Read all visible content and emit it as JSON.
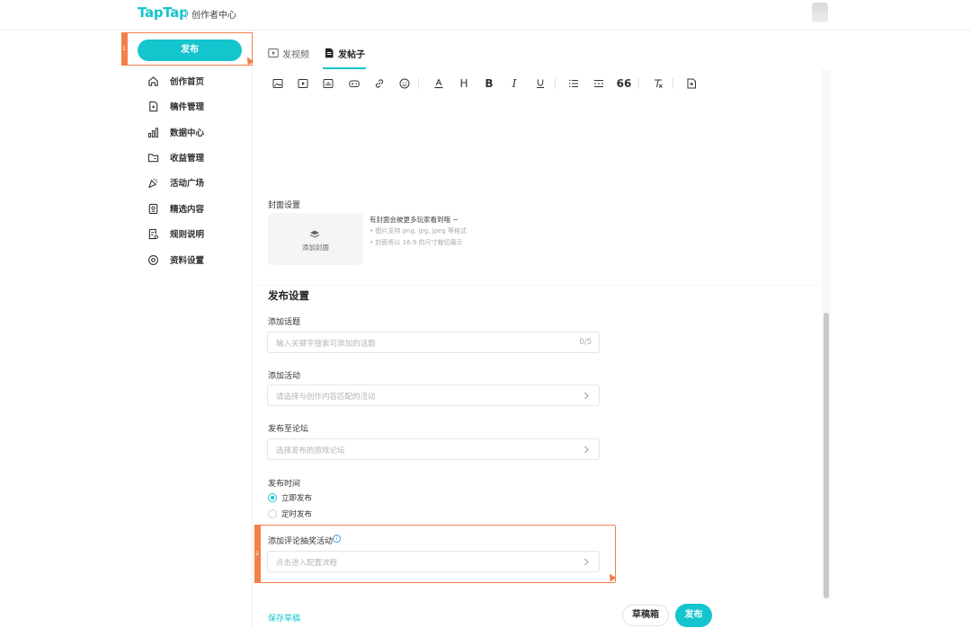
{
  "header": {
    "logo": "TapTap",
    "subtitle": "创作者中心"
  },
  "sidebar": {
    "publish_label": "发布",
    "highlight_tag_1": "1",
    "items": [
      {
        "label": "创作首页",
        "icon": "home-icon"
      },
      {
        "label": "稿件管理",
        "icon": "document-icon"
      },
      {
        "label": "数据中心",
        "icon": "bar-chart-icon"
      },
      {
        "label": "收益管理",
        "icon": "folder-icon"
      },
      {
        "label": "活动广场",
        "icon": "party-icon"
      },
      {
        "label": "精选内容",
        "icon": "badge-icon"
      },
      {
        "label": "规则说明",
        "icon": "rules-icon"
      },
      {
        "label": "资料设置",
        "icon": "settings-icon"
      }
    ]
  },
  "tabs": [
    {
      "label": "发视频",
      "icon": "video-icon",
      "active": false
    },
    {
      "label": "发帖子",
      "icon": "post-icon",
      "active": true
    }
  ],
  "toolbar": {
    "heading_letter": "H",
    "bold_letter": "B",
    "italic_letter": "I",
    "quote_label": "66"
  },
  "cover": {
    "title": "封面设置",
    "add_label": "添加封面",
    "tip": "有封面会被更多玩家看到哦 ~",
    "notes": [
      "图片支持 png, jpg, jpeg 等格式",
      "封面将以 16:9 的尺寸裁切展示"
    ]
  },
  "publish_settings": {
    "title": "发布设置",
    "topic": {
      "label": "添加话题",
      "placeholder": "输入关键字搜索可添加的话题",
      "count": "0/5"
    },
    "activity": {
      "label": "添加活动",
      "placeholder": "请选择与创作内容匹配的活动"
    },
    "forum": {
      "label": "发布至论坛",
      "placeholder": "选择发布的游戏论坛"
    },
    "time": {
      "label": "发布时间",
      "options": [
        "立即发布",
        "定时发布"
      ],
      "selected": "立即发布"
    },
    "lottery": {
      "label": "添加评论抽奖活动",
      "placeholder": "点击进入配置流程",
      "highlight_tag": "2"
    }
  },
  "footer": {
    "save_draft": "保存草稿",
    "draft_box": "草稿箱",
    "publish": "发布"
  },
  "colors": {
    "accent": "#15c5ce",
    "highlight": "#f4804a"
  }
}
